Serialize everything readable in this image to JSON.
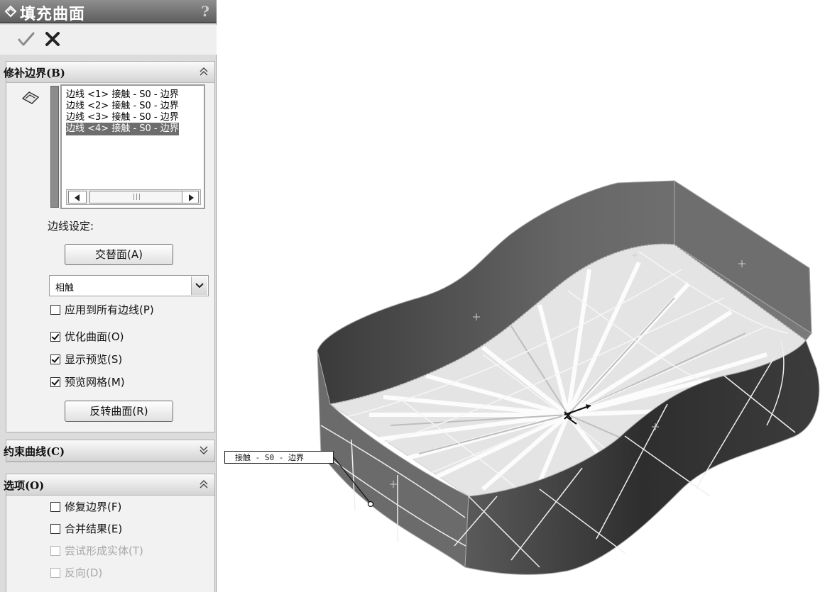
{
  "panel": {
    "title": "填充曲面",
    "help": "?",
    "ok_icon": "check-icon",
    "cancel_icon": "x-icon"
  },
  "boundary_section": {
    "title": "修补边界(B)",
    "edges": [
      "边线 <1> 接触 - S0 - 边界",
      "边线 <2> 接触 - S0 - 边界",
      "边线 <3> 接触 - S0 - 边界",
      "边线 <4> 接触 - S0 - 边界"
    ],
    "selected_edge_index": 3,
    "edge_settings_label": "边线设定:",
    "alternate_face_button": "交替面(A)",
    "curvature_control": "相触",
    "apply_all_label": "应用到所有边线(P)",
    "apply_all_checked": false,
    "optimize_label": "优化曲面(O)",
    "optimize_checked": true,
    "show_preview_label": "显示预览(S)",
    "show_preview_checked": true,
    "preview_mesh_label": "预览网格(M)",
    "preview_mesh_checked": true,
    "flip_button": "反转曲面(R)"
  },
  "constraint_section": {
    "title": "约束曲线(C)"
  },
  "options_section": {
    "title": "选项(O)",
    "fix_boundary_label": "修复边界(F)",
    "fix_boundary_checked": false,
    "merge_label": "合并结果(E)",
    "merge_checked": false,
    "try_solid_label": "尝试形成实体(T)",
    "try_solid_enabled": false,
    "reverse_label": "反向(D)",
    "reverse_enabled": false
  },
  "viewport": {
    "callout_label": "接触 - S0 - 边界"
  }
}
